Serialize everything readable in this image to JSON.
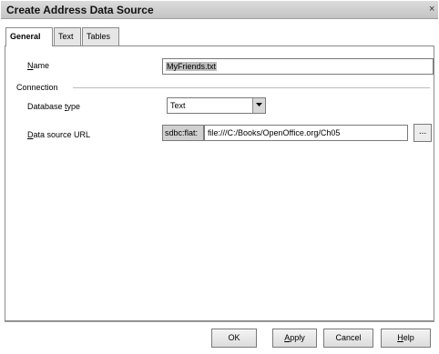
{
  "window": {
    "title": "Create Address Data Source",
    "close_glyph": "×"
  },
  "tabs": [
    {
      "label": "General"
    },
    {
      "label": "Text"
    },
    {
      "label": "Tables"
    }
  ],
  "general": {
    "name_label_u": "N",
    "name_label_rest": "ame",
    "name_value": "MyFriends.txt",
    "connection_label": "Connection",
    "db_type_label_a": "Database ",
    "db_type_label_u": "t",
    "db_type_label_b": "ype",
    "db_type_value": "Text",
    "url_label_u": "D",
    "url_label_rest": "ata source URL",
    "url_prefix": "sdbc:flat:",
    "url_value": "file:///C:/Books/OpenOffice.org/Ch05",
    "browse_label": "..."
  },
  "buttons": {
    "ok": "OK",
    "apply_u": "A",
    "apply_rest": "pply",
    "cancel": "Cancel",
    "help_u": "H",
    "help_rest": "elp"
  }
}
